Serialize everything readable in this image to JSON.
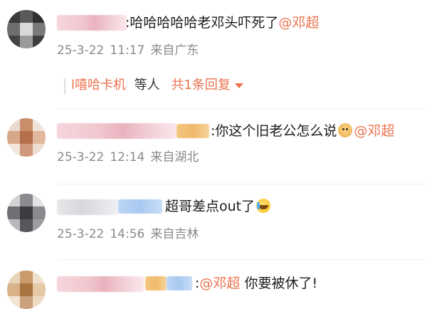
{
  "comments": [
    {
      "text_before": ":哈哈哈哈哈老邓头吓死了",
      "mention": "@邓超",
      "text_after": "",
      "date": "25-3-22",
      "time": "11:17",
      "location": "来自广东",
      "replies": {
        "user": "l嘻哈卡机",
        "suffix": "等人",
        "count_label": "共1条回复",
        "caret_icon": "chevron-down-icon"
      }
    },
    {
      "text_before": ":你这个旧老公怎么说",
      "emoji": "dog-face-icon",
      "mention": "@邓超",
      "text_after": "",
      "date": "25-3-22",
      "time": "12:14",
      "location": "来自湖北"
    },
    {
      "text_before": "超哥差点out了",
      "emoji": "crying-laughing-icon",
      "mention": "",
      "text_after": "",
      "date": "25-3-22",
      "time": "14:56",
      "location": "来自吉林"
    },
    {
      "text_before": ":",
      "mention": "@邓超",
      "text_after": " 你要被休了!"
    }
  ],
  "colors": {
    "mention": "#eb7350",
    "meta": "#8a8a8a",
    "text": "#1b1b1b"
  }
}
